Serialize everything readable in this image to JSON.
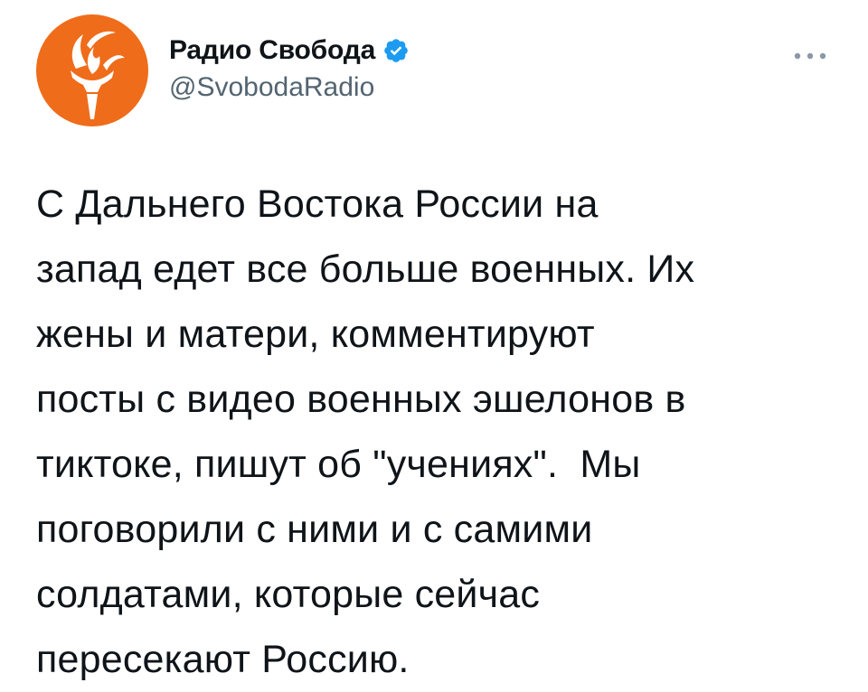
{
  "tweet": {
    "author": {
      "name": "Радио Свобода",
      "handle": "@SvobodaRadio",
      "verified": true,
      "avatar_icon": "radio-svoboda-torch-logo",
      "avatar_color": "#ef6c1a"
    },
    "more_icon": "more-dots-icon",
    "verified_icon": "verified-badge-icon",
    "verified_color": "#1d9bf0",
    "text": "С Дальнего Востока России на\nзапад едет все больше военных. Их\nжены и матери, комментируют\nпосты с видео военных эшелонов в\nтиктоке, пишут об \"учениях\".  Мы\nпоговорили с ними и с самими\nсолдатами, которые сейчас\nпересекают Россию."
  }
}
